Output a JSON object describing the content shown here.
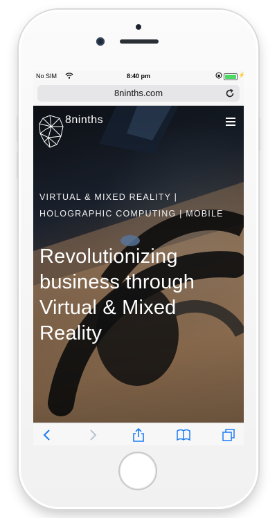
{
  "status_bar": {
    "carrier": "No SIM",
    "time": "8:40 pm",
    "battery_level": 1.0,
    "battery_color": "#4cd964"
  },
  "browser": {
    "url": "8ninths.com",
    "reload_icon": "reload-icon",
    "toolbar": {
      "back_icon": "chevron-left-icon",
      "forward_icon": "chevron-right-icon",
      "share_icon": "share-icon",
      "bookmarks_icon": "book-icon",
      "tabs_icon": "tabs-icon",
      "accent_color": "#1a7cf5"
    }
  },
  "site": {
    "brand": {
      "logo_icon": "geometric-head-logo",
      "name": "8ninths"
    },
    "menu_icon": "hamburger-menu-icon",
    "tagline_lines": [
      "VIRTUAL & MIXED REALITY |",
      "HOLOGRAPHIC COMPUTING | MOBILE"
    ],
    "headline_lines": [
      "Revolutionizing",
      "business through",
      "Virtual & Mixed",
      "Reality"
    ]
  }
}
